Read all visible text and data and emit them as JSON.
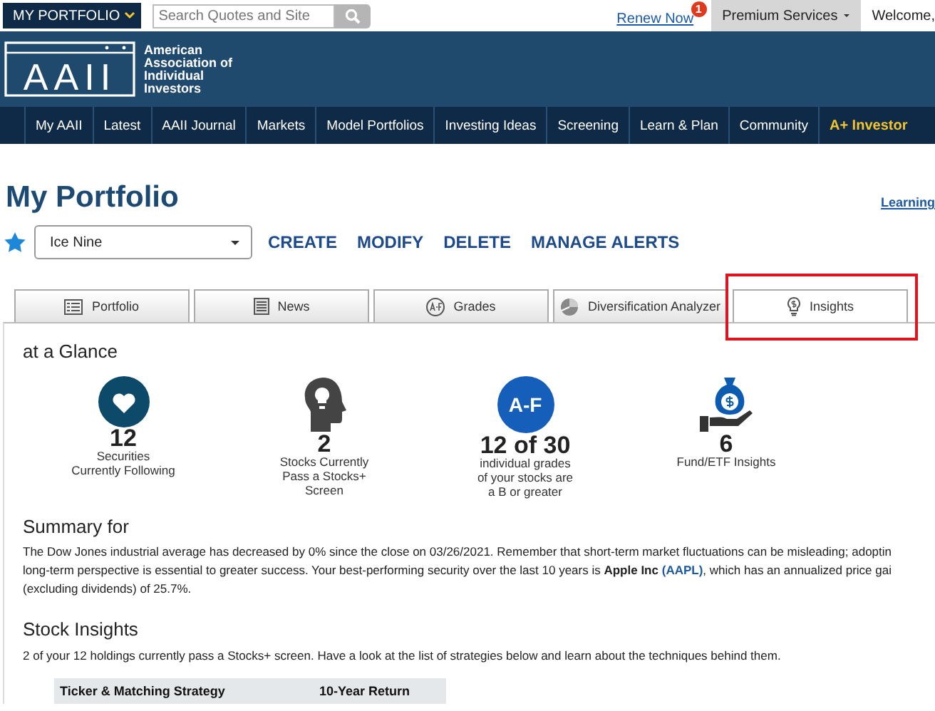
{
  "topbar": {
    "portfolio_button": "MY PORTFOLIO",
    "search": {
      "placeholder": "Search Quotes and Site"
    },
    "renew": {
      "label": "Renew Now",
      "badge": "1"
    },
    "premium": "Premium Services",
    "welcome": "Welcome,"
  },
  "logo": {
    "mark": "AAII",
    "name_lines": [
      "American",
      "Association of",
      "Individual",
      "Investors"
    ]
  },
  "nav": [
    {
      "label": "My AAII",
      "kind": "regular"
    },
    {
      "label": "Latest",
      "kind": "regular"
    },
    {
      "label": "AAII Journal",
      "kind": "regular"
    },
    {
      "label": "Markets",
      "kind": "regular"
    },
    {
      "label": "Model Portfolios",
      "kind": "regular"
    },
    {
      "label": "Investing Ideas",
      "kind": "regular"
    },
    {
      "label": "Screening",
      "kind": "regular"
    },
    {
      "label": "Learn & Plan",
      "kind": "regular"
    },
    {
      "label": "Community",
      "kind": "regular"
    },
    {
      "label": "A+ Investor",
      "kind": "highlight"
    }
  ],
  "page": {
    "title": "My Portfolio",
    "learning_link": "Learning"
  },
  "portfolio_bar": {
    "selected_portfolio": "Ice Nine",
    "actions": [
      "CREATE",
      "MODIFY",
      "DELETE",
      "MANAGE ALERTS"
    ]
  },
  "tabs": [
    {
      "label": "Portfolio",
      "kind": "list",
      "selected": false,
      "highlighted": false
    },
    {
      "label": "News",
      "kind": "news",
      "selected": false,
      "highlighted": false
    },
    {
      "label": "Grades",
      "kind": "grades",
      "selected": false,
      "highlighted": false
    },
    {
      "label": "Diversification Analyzer",
      "kind": "pie",
      "selected": false,
      "highlighted": false
    },
    {
      "label": "Insights",
      "kind": "bulb",
      "selected": true,
      "highlighted": true
    }
  ],
  "glance": {
    "heading": "at a Glance",
    "stats": [
      {
        "kind": "heart",
        "value": "12",
        "caption_lines": [
          "Securities",
          "Currently Following"
        ]
      },
      {
        "kind": "head",
        "value": "2",
        "caption_lines": [
          "Stocks Currently",
          "Pass a Stocks+",
          "Screen"
        ]
      },
      {
        "kind": "badge",
        "badge": "A-F",
        "value": "12 of 30",
        "caption_lines": [
          "individual grades",
          "of your stocks are",
          "a B or greater"
        ]
      },
      {
        "kind": "moneybag",
        "value": "6",
        "caption_lines": [
          "Fund/ETF Insights"
        ]
      }
    ]
  },
  "summary": {
    "heading": "Summary for",
    "lines": [
      "The Dow Jones industrial average has decreased by 0% since the close on 03/26/2021. Remember that short-term market fluctuations can be misleading; adoptin",
      "long-term perspective is essential to greater success. Your best-performing security over the last 10 years is **Apple Inc** ",
      "(excluding dividends) of 25.7%."
    ],
    "link": "(AAPL)",
    "line2_tail": ", which has an annualized price gai"
  },
  "stock_insights": {
    "heading": "Stock Insights",
    "text": "2 of your 12 holdings currently pass a Stocks+ screen. Have a look at the list of strategies below and learn about the techniques behind them.",
    "columns": [
      "Ticker & Matching Strategy",
      "10-Year Return"
    ]
  }
}
